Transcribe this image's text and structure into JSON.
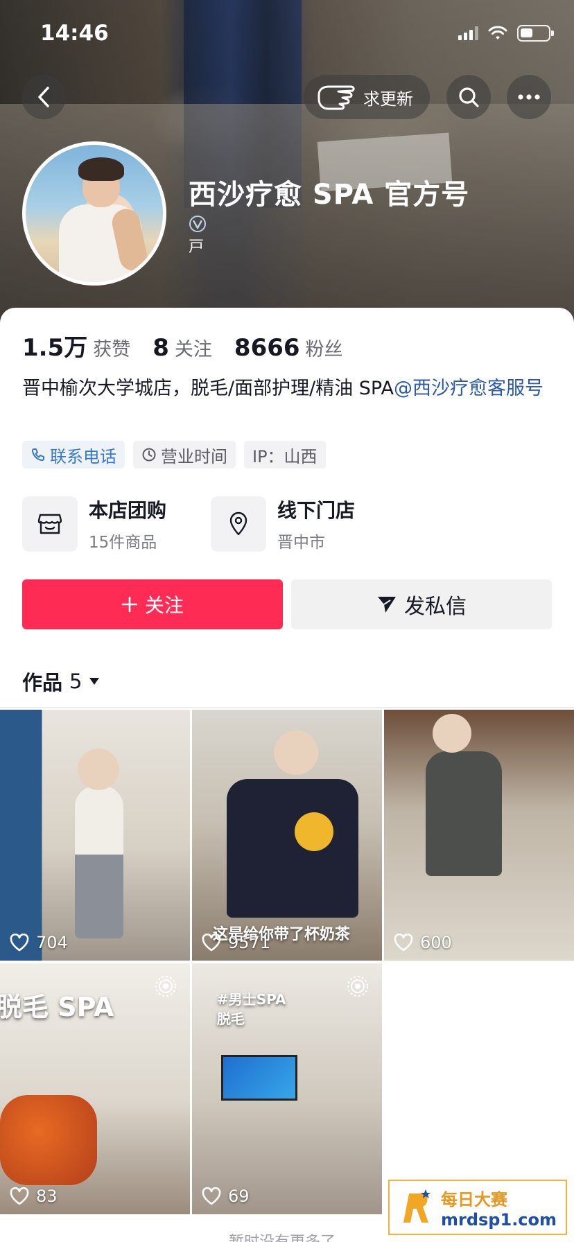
{
  "status_bar": {
    "time": "14:46"
  },
  "nav": {
    "update_label": "求更新"
  },
  "profile": {
    "name": "西沙疗愈 SPA 官方号",
    "door_glyph": "戸"
  },
  "stats": [
    {
      "value": "1.5万",
      "label": "获赞"
    },
    {
      "value": "8",
      "label": "关注"
    },
    {
      "value": "8666",
      "label": "粉丝"
    }
  ],
  "bio": {
    "text": "晋中榆次大学城店，脱毛/面部护理/精油 SPA",
    "mention": "@西沙疗愈客服号"
  },
  "tags": [
    {
      "label": "联系电话",
      "icon": "phone-icon"
    },
    {
      "label": "营业时间",
      "icon": "clock-icon"
    },
    {
      "label": "IP：山西",
      "icon": ""
    }
  ],
  "shop": [
    {
      "title": "本店团购",
      "subtitle": "15件商品",
      "icon": "store-icon"
    },
    {
      "title": "线下门店",
      "subtitle": "晋中市",
      "icon": "location-pin-icon"
    }
  ],
  "actions": {
    "follow_label": "关注",
    "message_label": "发私信"
  },
  "works": {
    "label": "作品",
    "count": "5"
  },
  "videos": [
    {
      "likes": "704",
      "caption": ""
    },
    {
      "likes": "9571",
      "caption": "这是给你带了杯奶茶"
    },
    {
      "likes": "600",
      "caption": ""
    },
    {
      "likes": "83",
      "caption": "脱毛 SPA"
    },
    {
      "likes": "69",
      "caption": "#男士SPA\n脱毛"
    }
  ],
  "footer": {
    "more_text": "暂时没有更多了"
  },
  "watermark": {
    "line1": "每日大赛",
    "line2": "mrdsp1.com"
  },
  "colors": {
    "accent": "#fe2c55",
    "mention": "#2c5aa8",
    "phone_tag": "#3a78c8"
  }
}
